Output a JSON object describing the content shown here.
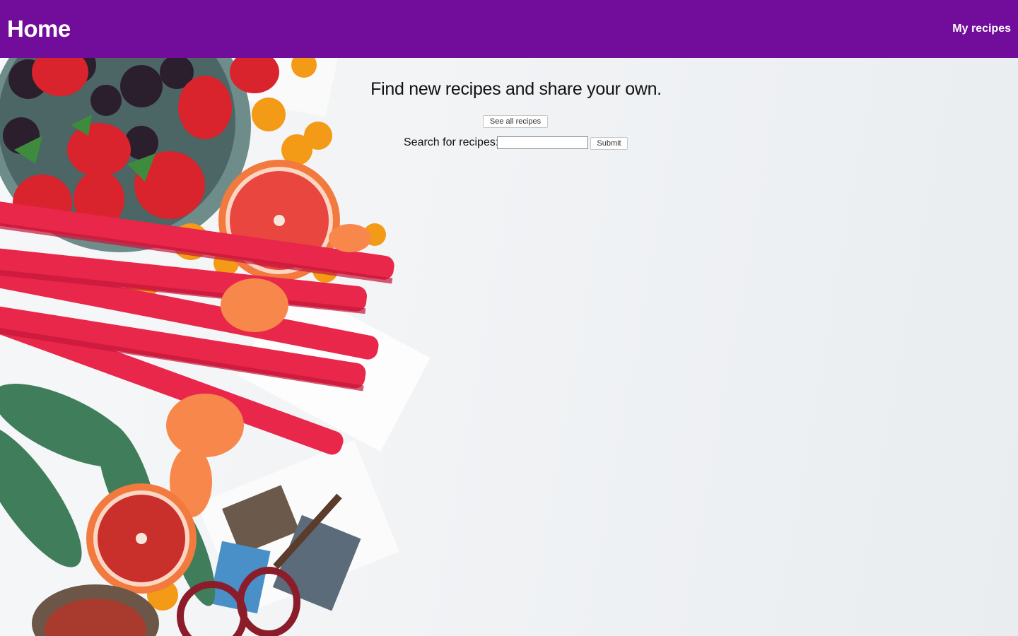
{
  "navbar": {
    "brand": "Home",
    "my_recipes_link": "My recipes",
    "color": "#720c9b"
  },
  "main": {
    "heading": "Find new recipes and share your own.",
    "see_all_button": "See all recipes",
    "search_label": "Search for recipes:",
    "search_value": "",
    "submit_button": "Submit"
  },
  "background_image": {
    "icon": "fruit-and-flowers-photo"
  }
}
